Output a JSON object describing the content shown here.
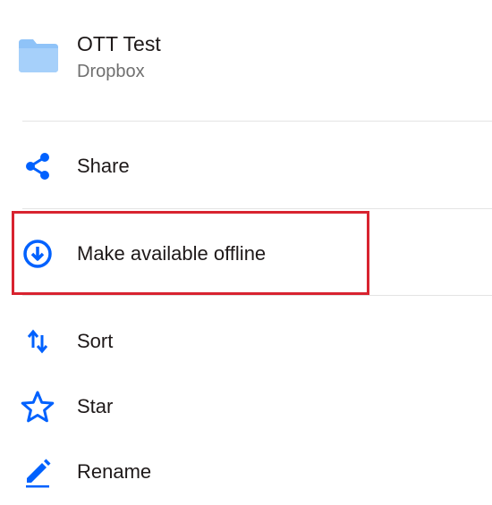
{
  "header": {
    "folder_icon": "folder-icon",
    "title": "OTT Test",
    "subtitle": "Dropbox"
  },
  "menu": {
    "items": [
      {
        "label": "Share",
        "icon": "share-icon"
      },
      {
        "label": "Make available offline",
        "icon": "download-circle-icon"
      },
      {
        "label": "Sort",
        "icon": "sort-arrows-icon"
      },
      {
        "label": "Star",
        "icon": "star-outline-icon"
      },
      {
        "label": "Rename",
        "icon": "pencil-icon"
      }
    ]
  },
  "colors": {
    "accent": "#0061fe",
    "folder": "#8fc3f8",
    "highlight": "#d8232f",
    "divider": "#e4e4e4",
    "subtitle": "#6f6f6f"
  }
}
